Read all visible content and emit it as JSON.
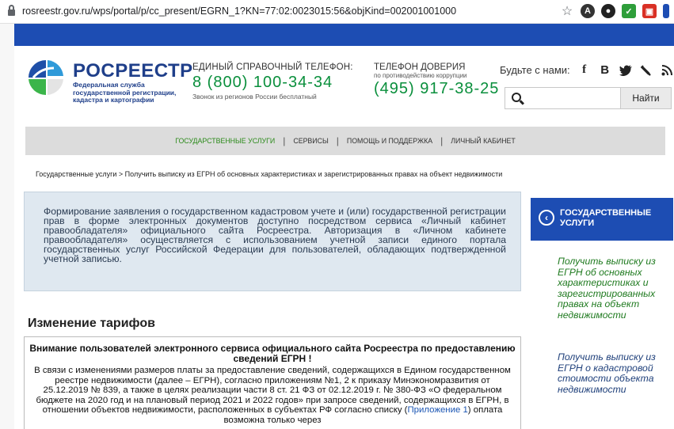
{
  "browser": {
    "url": "rosreestr.gov.ru/wps/portal/p/cc_present/EGRN_1?KN=77:02:0023015:56&objKind=002001001000"
  },
  "header": {
    "logo_title": "РОСРЕЕСТР",
    "logo_subtitle": "Федеральная служба государственной регистрации, кадастра и картографии",
    "phone_label": "ЕДИНЫЙ СПРАВОЧНЫЙ ТЕЛЕФОН:",
    "phone_number": "8 (800) 100-34-34",
    "phone_note": "Звонок из регионов России бесплатный",
    "trust_label": "ТЕЛЕФОН ДОВЕРИЯ",
    "trust_sub": "по противодействию коррупции",
    "trust_number": "(495) 917-38-25",
    "social_label": "Будьте с нами:",
    "social_icons": [
      "f",
      "B",
      "t",
      "lj",
      "rss"
    ],
    "search_placeholder": "",
    "search_button": "Найти"
  },
  "nav": {
    "items": [
      "ГОСУДАРСТВЕННЫЕ УСЛУГИ",
      "СЕРВИСЫ",
      "ПОМОЩЬ И ПОДДЕРЖКА",
      "ЛИЧНЫЙ КАБИНЕТ"
    ],
    "separator": "|"
  },
  "breadcrumb": {
    "text": "Государственные услуги  >  Получить выписку из ЕГРН об основных характеристиках и зарегистрированных правах на объект недвижимости"
  },
  "info": {
    "text": "Формирование заявления о государственном кадастровом учете и (или) государственной регистрации прав в форме электронных документов доступно посредством сервиса «Личный кабинет правообладателя» официального сайта Росреестра. Авторизация в «Личном кабинете правообладателя» осуществляется с использованием учетной записи единого портала государственных услуг Российской Федерации для пользователей, обладающих подтвержденной учетной записью."
  },
  "tariffs": {
    "title": "Изменение тарифов",
    "notice_title": "Внимание пользователей электронного сервиса официального сайта Росреестра по предоставлению сведений ЕГРН !",
    "notice_body": "В связи с изменениями размеров платы за предоставление сведений, содержащихся в Едином государственном реестре недвижимости (далее – ЕГРН), согласно приложениям №1, 2 к приказу Минэкономразвития от 25.12.2019 № 839, а также в целях реализации части 8 ст. 21 ФЗ от 02.12.2019 г. № 380-ФЗ «О федеральном бюджете на 2020 год и на плановый период 2021 и 2022 годов» при запросе сведений, содержащихся в ЕГРН, в отношении объектов недвижимости, расположенных в субъектах РФ согласно списку (",
    "notice_link": "Приложение 1",
    "notice_tail": ") оплата возможна только через"
  },
  "sidebar": {
    "header": "ГОСУДАРСТВЕННЫЕ УСЛУГИ",
    "links": [
      "Получить выписку из ЕГРН об основных характеристиках и зарегистрированных правах на объект недвижимости",
      "Получить выписку из ЕГРН о кадастровой стоимости объекта недвижимости"
    ]
  },
  "colors": {
    "brand_blue": "#1d4db3",
    "phone_green": "#0a8f3c",
    "active_nav_green": "#2b8a1a"
  }
}
